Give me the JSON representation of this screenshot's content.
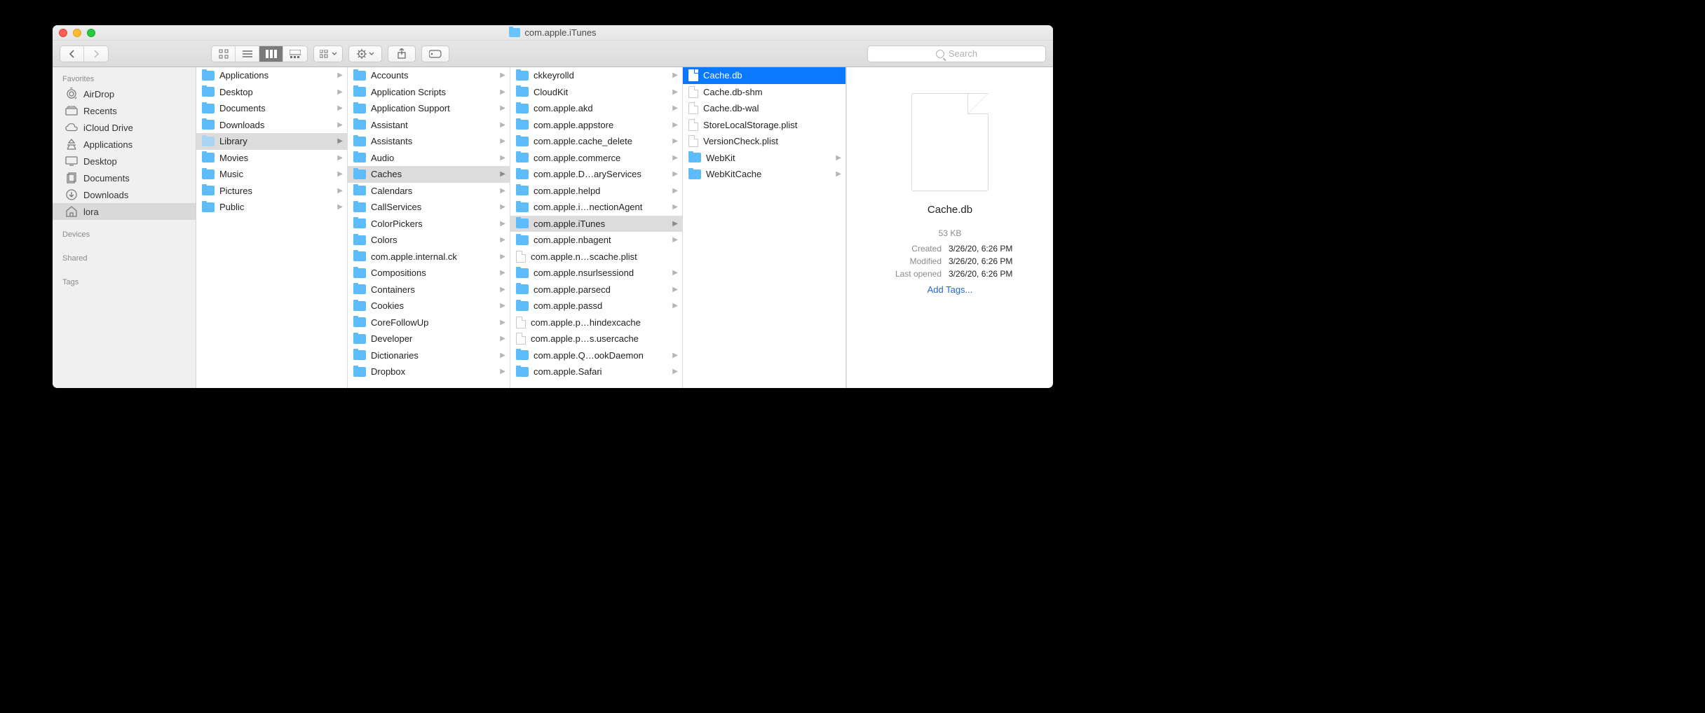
{
  "window": {
    "title": "com.apple.iTunes"
  },
  "toolbar": {
    "search_placeholder": "Search"
  },
  "sidebar": {
    "sections": {
      "favorites_label": "Favorites",
      "devices_label": "Devices",
      "shared_label": "Shared",
      "tags_label": "Tags"
    },
    "favorites": [
      {
        "label": "AirDrop",
        "icon": "airdrop"
      },
      {
        "label": "Recents",
        "icon": "recents"
      },
      {
        "label": "iCloud Drive",
        "icon": "cloud"
      },
      {
        "label": "Applications",
        "icon": "apps"
      },
      {
        "label": "Desktop",
        "icon": "desktop"
      },
      {
        "label": "Documents",
        "icon": "documents"
      },
      {
        "label": "Downloads",
        "icon": "downloads"
      },
      {
        "label": "lora",
        "icon": "home",
        "selected": true
      }
    ]
  },
  "columns": [
    {
      "items": [
        {
          "name": "Applications",
          "type": "folder",
          "children": true
        },
        {
          "name": "Desktop",
          "type": "folder",
          "children": true
        },
        {
          "name": "Documents",
          "type": "folder",
          "children": true
        },
        {
          "name": "Downloads",
          "type": "folder",
          "children": true
        },
        {
          "name": "Library",
          "type": "folder",
          "children": true,
          "path_selected": true,
          "dim": true
        },
        {
          "name": "Movies",
          "type": "folder",
          "children": true
        },
        {
          "name": "Music",
          "type": "folder",
          "children": true
        },
        {
          "name": "Pictures",
          "type": "folder",
          "children": true
        },
        {
          "name": "Public",
          "type": "folder",
          "children": true
        }
      ]
    },
    {
      "items": [
        {
          "name": "Accounts",
          "type": "folder",
          "children": true
        },
        {
          "name": "Application Scripts",
          "type": "folder",
          "children": true
        },
        {
          "name": "Application Support",
          "type": "folder",
          "children": true
        },
        {
          "name": "Assistant",
          "type": "folder",
          "children": true
        },
        {
          "name": "Assistants",
          "type": "folder",
          "children": true
        },
        {
          "name": "Audio",
          "type": "folder",
          "children": true
        },
        {
          "name": "Caches",
          "type": "folder",
          "children": true,
          "path_selected": true
        },
        {
          "name": "Calendars",
          "type": "folder",
          "children": true
        },
        {
          "name": "CallServices",
          "type": "folder",
          "children": true
        },
        {
          "name": "ColorPickers",
          "type": "folder",
          "children": true
        },
        {
          "name": "Colors",
          "type": "folder",
          "children": true
        },
        {
          "name": "com.apple.internal.ck",
          "type": "folder",
          "children": true
        },
        {
          "name": "Compositions",
          "type": "folder",
          "children": true
        },
        {
          "name": "Containers",
          "type": "folder",
          "children": true
        },
        {
          "name": "Cookies",
          "type": "folder",
          "children": true
        },
        {
          "name": "CoreFollowUp",
          "type": "folder",
          "children": true
        },
        {
          "name": "Developer",
          "type": "folder",
          "children": true
        },
        {
          "name": "Dictionaries",
          "type": "folder",
          "children": true
        },
        {
          "name": "Dropbox",
          "type": "folder",
          "children": true
        }
      ]
    },
    {
      "items": [
        {
          "name": "ckkeyrolld",
          "type": "folder",
          "children": true
        },
        {
          "name": "CloudKit",
          "type": "folder",
          "children": true
        },
        {
          "name": "com.apple.akd",
          "type": "folder",
          "children": true
        },
        {
          "name": "com.apple.appstore",
          "type": "folder",
          "children": true
        },
        {
          "name": "com.apple.cache_delete",
          "type": "folder",
          "children": true
        },
        {
          "name": "com.apple.commerce",
          "type": "folder",
          "children": true
        },
        {
          "name": "com.apple.D…aryServices",
          "type": "folder",
          "children": true
        },
        {
          "name": "com.apple.helpd",
          "type": "folder",
          "children": true
        },
        {
          "name": "com.apple.i…nectionAgent",
          "type": "folder",
          "children": true
        },
        {
          "name": "com.apple.iTunes",
          "type": "folder",
          "children": true,
          "path_selected": true
        },
        {
          "name": "com.apple.nbagent",
          "type": "folder",
          "children": true
        },
        {
          "name": "com.apple.n…scache.plist",
          "type": "plist",
          "children": false
        },
        {
          "name": "com.apple.nsurlsessiond",
          "type": "folder",
          "children": true
        },
        {
          "name": "com.apple.parsecd",
          "type": "folder",
          "children": true
        },
        {
          "name": "com.apple.passd",
          "type": "folder",
          "children": true
        },
        {
          "name": "com.apple.p…hindexcache",
          "type": "file",
          "children": false
        },
        {
          "name": "com.apple.p…s.usercache",
          "type": "file",
          "children": false
        },
        {
          "name": "com.apple.Q…ookDaemon",
          "type": "folder",
          "children": true
        },
        {
          "name": "com.apple.Safari",
          "type": "folder",
          "children": true
        }
      ]
    },
    {
      "items": [
        {
          "name": "Cache.db",
          "type": "file",
          "children": false,
          "selected": true
        },
        {
          "name": "Cache.db-shm",
          "type": "file",
          "children": false
        },
        {
          "name": "Cache.db-wal",
          "type": "file",
          "children": false
        },
        {
          "name": "StoreLocalStorage.plist",
          "type": "plist",
          "children": false
        },
        {
          "name": "VersionCheck.plist",
          "type": "plist",
          "children": false
        },
        {
          "name": "WebKit",
          "type": "folder",
          "children": true
        },
        {
          "name": "WebKitCache",
          "type": "folder",
          "children": true
        }
      ]
    }
  ],
  "preview": {
    "filename": "Cache.db",
    "size": "53 KB",
    "rows": [
      {
        "label": "Created",
        "value": "3/26/20, 6:26 PM"
      },
      {
        "label": "Modified",
        "value": "3/26/20, 6:26 PM"
      },
      {
        "label": "Last opened",
        "value": "3/26/20, 6:26 PM"
      }
    ],
    "add_tags": "Add Tags..."
  }
}
